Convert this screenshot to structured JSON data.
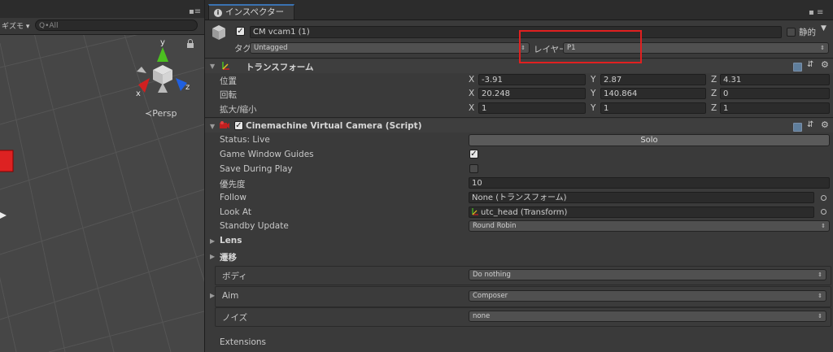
{
  "scene": {
    "gizmo_label": "ギズモ",
    "search_placeholder": "Q•All",
    "axis_x": "x",
    "axis_y": "y",
    "axis_z": "z",
    "persp_label": "≺Persp"
  },
  "inspector": {
    "tab_label": "インスペクター",
    "header": {
      "object_name": "CM vcam1 (1)",
      "static_label": "静的",
      "tag_label": "タグ",
      "tag_value": "Untagged",
      "layer_label": "レイヤー",
      "layer_value": "P1"
    },
    "transform": {
      "title": "トランスフォーム",
      "rows": [
        {
          "label": "位置",
          "x": "-3.91",
          "y": "2.87",
          "z": "4.31"
        },
        {
          "label": "回転",
          "x": "20.248",
          "y": "140.864",
          "z": "0"
        },
        {
          "label": "拡大/縮小",
          "x": "1",
          "y": "1",
          "z": "1"
        }
      ],
      "axis_labels": [
        "X",
        "Y",
        "Z"
      ]
    },
    "vcam": {
      "title": "Cinemachine Virtual Camera (Script)",
      "status_label": "Status: Live",
      "solo_label": "Solo",
      "game_window_guides_label": "Game Window Guides",
      "game_window_guides_checked": true,
      "save_during_play_label": "Save During Play",
      "save_during_play_checked": false,
      "priority_label": "優先度",
      "priority_value": "10",
      "follow_label": "Follow",
      "follow_value": "None (トランスフォーム)",
      "look_at_label": "Look At",
      "look_at_value": "utc_head (Transform)",
      "standby_label": "Standby Update",
      "standby_value": "Round Robin",
      "lens_label": "Lens",
      "transition_label": "遷移",
      "body_label": "ボディ",
      "body_value": "Do nothing",
      "aim_label": "Aim",
      "aim_value": "Composer",
      "noise_label": "ノイズ",
      "noise_value": "none",
      "extensions_label": "Extensions"
    }
  },
  "colors": {
    "highlight": "#e02020",
    "axis_x": "#d02020",
    "axis_y": "#4cc020",
    "axis_z": "#2060e0"
  }
}
